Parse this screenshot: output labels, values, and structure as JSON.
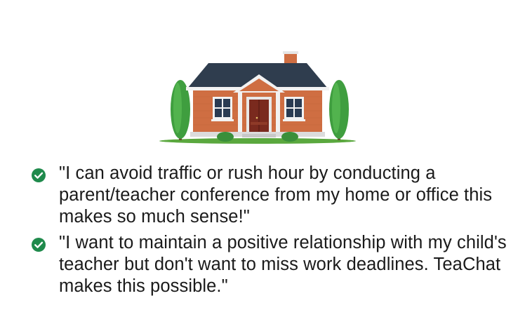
{
  "illustration": {
    "icon": "house-icon",
    "colors": {
      "roof": "#2f3d4e",
      "brick": "#cf6e42",
      "door": "#7a2a1e",
      "tree": "#3a9a3c",
      "lawn": "#4f9a3a"
    }
  },
  "testimonials": [
    {
      "icon": "check-circle-icon",
      "text": "\"I can avoid traffic or rush hour by conducting a parent/teacher conference from my home or office this makes so much sense!\""
    },
    {
      "icon": "check-circle-icon",
      "text": "\"I want to maintain a positive relationship with my child's teacher but don't want to miss work deadlines. TeaChat makes this possible.\""
    }
  ],
  "colors": {
    "check": "#1f8a4c",
    "text": "#1a1a1a"
  }
}
